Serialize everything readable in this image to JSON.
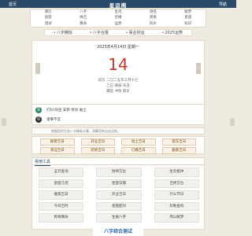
{
  "topbar": {
    "home": "首页",
    "title": "星运阁",
    "menu": "导航"
  },
  "nav": [
    "黄历",
    "八字",
    "生肖",
    "测名",
    "解梦",
    "星座",
    "择吉",
    "合婚",
    "周易",
    "星座",
    "测试",
    "算命",
    "运势",
    "风水",
    "知识"
  ],
  "quickbar": [
    "八字精批",
    "八字合婚",
    "事业财运",
    "2025运势"
  ],
  "date_card": {
    "date_line": "2025年4月14日 星期一",
    "day": "14",
    "lunar_1": "农历 二〇二五年三月十七",
    "lunar_2": "乙巳 庚辰 辛丑",
    "lunar_3": "属蛇 冲兔 煞东"
  },
  "yiji": {
    "yi_badge": "宜",
    "yi_text": "打扫 除虫 安葬 修坟 破土",
    "ji_badge": "忌",
    "ji_text": "诸事不宜"
  },
  "notice": "根据您的生辰八字精准计算，测算您的吉凶运势。",
  "lucky": [
    "嫁娶吉日",
    "开业吉日",
    "动土吉日",
    "提车吉日",
    "领证吉日",
    "装修吉日",
    "订婚吉日",
    "搬家吉日"
  ],
  "tools": {
    "head": "常用工具",
    "items": [
      "五行查询",
      "财神方位",
      "生肖相冲",
      "星座几何",
      "星座日期",
      "吉神方位",
      "搬家吉日",
      "开业吉日",
      "什么节日",
      "今日吉时",
      "星座配对",
      "卦象查询",
      "称骨算命",
      "生辰八字",
      "周公解梦"
    ]
  },
  "banner": "八字综合测试"
}
